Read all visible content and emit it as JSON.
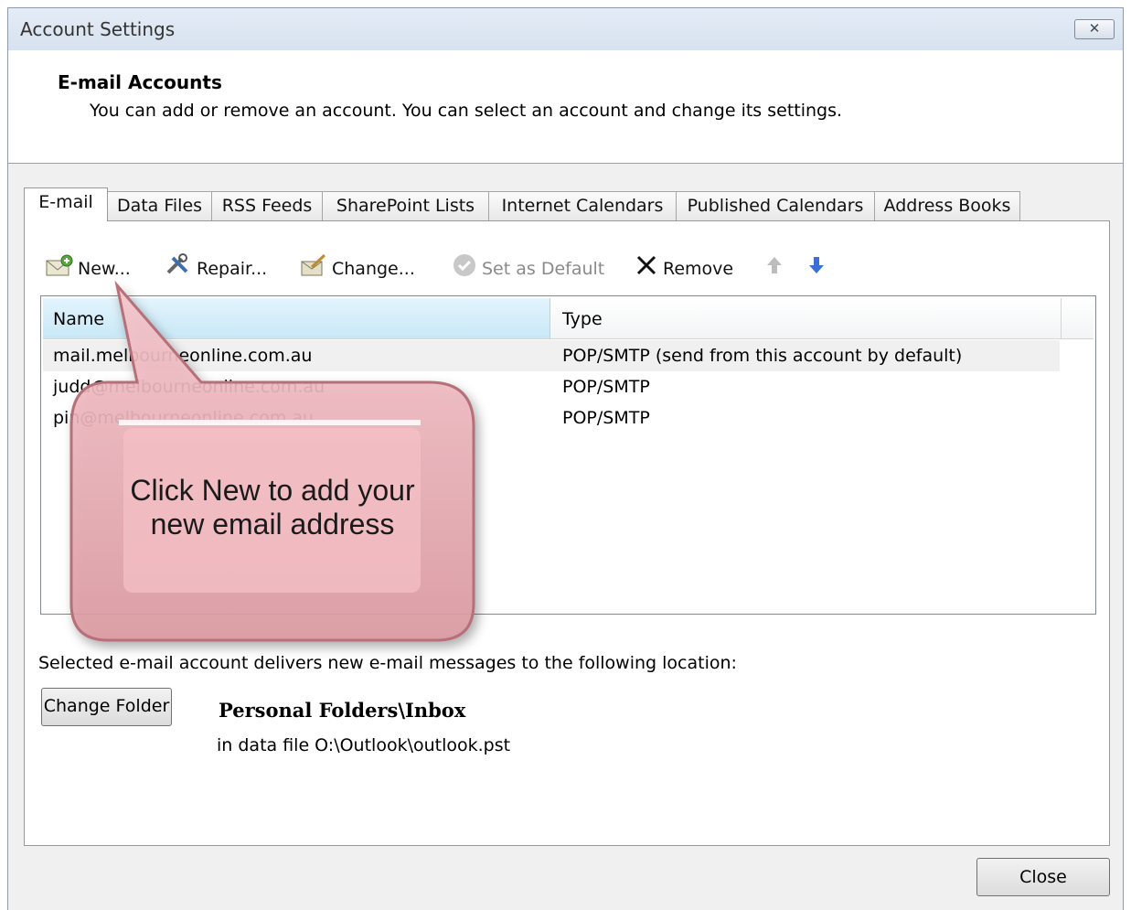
{
  "window": {
    "title": "Account Settings",
    "close_glyph": "✕"
  },
  "header": {
    "title": "E-mail Accounts",
    "description": "You can add or remove an account. You can select an account and change its settings."
  },
  "tabs": [
    {
      "label": "E-mail"
    },
    {
      "label": "Data Files"
    },
    {
      "label": "RSS Feeds"
    },
    {
      "label": "SharePoint Lists"
    },
    {
      "label": "Internet Calendars"
    },
    {
      "label": "Published Calendars"
    },
    {
      "label": "Address Books"
    }
  ],
  "toolbar": {
    "new": "New...",
    "repair": "Repair...",
    "change": "Change...",
    "set_default": "Set as Default",
    "remove": "Remove"
  },
  "list": {
    "columns": [
      "Name",
      "Type"
    ],
    "rows": [
      {
        "name": "mail.melbourneonline.com.au",
        "type": "POP/SMTP (send from this account by default)"
      },
      {
        "name": "judd@melbourneonline.com.au",
        "type": "POP/SMTP"
      },
      {
        "name": "pin@melbourneonline.com.au",
        "type": "POP/SMTP"
      }
    ]
  },
  "delivery": {
    "text": "Selected e-mail account delivers new e-mail messages to the following location:",
    "change_folder": "Change Folder",
    "folder": "Personal Folders\\Inbox",
    "path": "in data file O:\\Outlook\\outlook.pst"
  },
  "close_label": "Close",
  "callout": {
    "line1": "Click New to add your",
    "line2": "new email address"
  }
}
